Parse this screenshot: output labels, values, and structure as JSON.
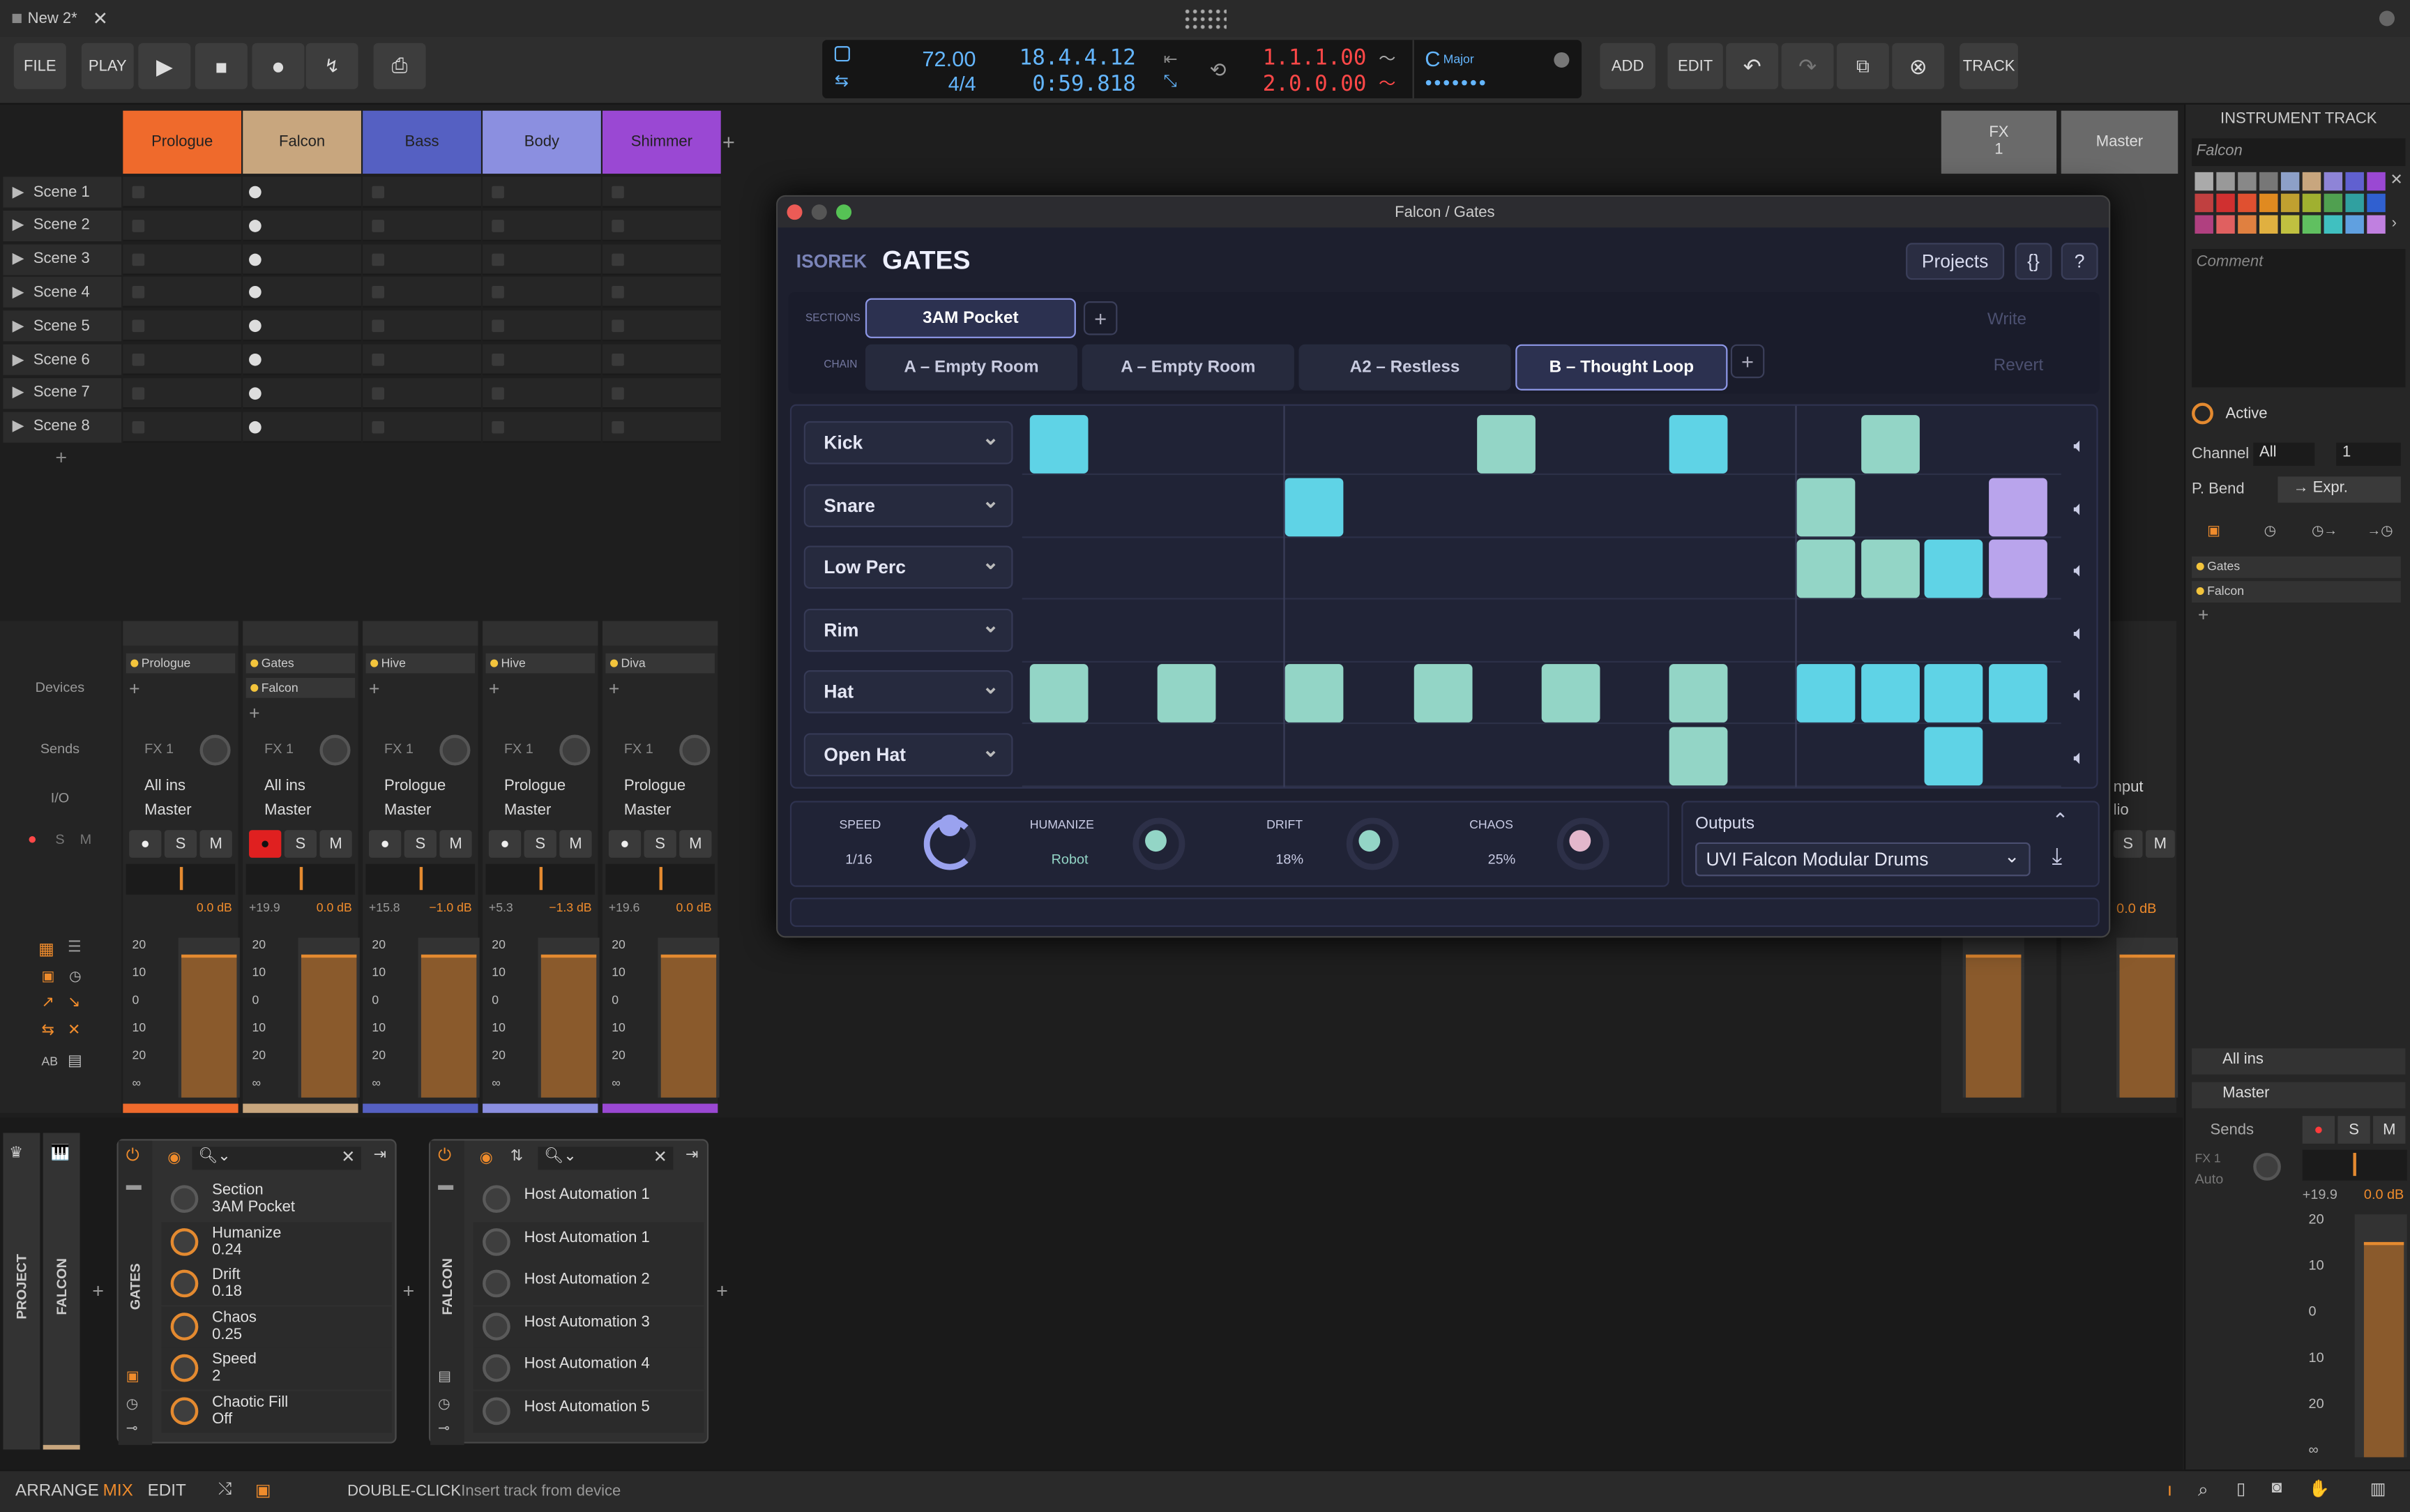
{
  "titlebar": {
    "tab": "New 2*"
  },
  "toolbar": {
    "file": "FILE",
    "play": "PLAY",
    "add": "ADD",
    "edit": "EDIT",
    "track": "TRACK",
    "tempo": "72.00",
    "sig": "4/4",
    "position": "18.4.4.12",
    "time": "0:59.818",
    "loop_start": "1.1.1.00",
    "loop_end": "2.0.0.00",
    "key_note": "C",
    "key_mode": "Major"
  },
  "tracks": [
    "Prologue",
    "Falcon",
    "Bass",
    "Body",
    "Shimmer"
  ],
  "track_colors": [
    "#ef6a2c",
    "#c8a67e",
    "#5560c2",
    "#8b8fe0",
    "#9a48d3"
  ],
  "fx": {
    "fx1_line1": "FX",
    "fx1_line2": "1",
    "master": "Master"
  },
  "scenes": [
    "Scene 1",
    "Scene 2",
    "Scene 3",
    "Scene 4",
    "Scene 5",
    "Scene 6",
    "Scene 7",
    "Scene 8"
  ],
  "mixer": {
    "section_devices": "Devices",
    "section_sends": "Sends",
    "section_io": "I/O",
    "strips": [
      {
        "devices": [
          "Prologue"
        ],
        "send": "FX 1",
        "input": "All ins",
        "output": "Master",
        "peak": "",
        "vol": "0.0 dB"
      },
      {
        "devices": [
          "Gates",
          "Falcon"
        ],
        "send": "FX 1",
        "input": "All ins",
        "output": "Master",
        "peak": "+19.9",
        "vol": "0.0 dB"
      },
      {
        "devices": [
          "Hive"
        ],
        "send": "FX 1",
        "input": "Prologue",
        "output": "Master",
        "peak": "+15.8",
        "vol": "−1.0 dB"
      },
      {
        "devices": [
          "Hive"
        ],
        "send": "FX 1",
        "input": "Prologue",
        "output": "Master",
        "peak": "+5.3",
        "vol": "−1.3 dB"
      },
      {
        "devices": [
          "Diva"
        ],
        "send": "FX 1",
        "input": "Prologue",
        "output": "Master",
        "peak": "+19.6",
        "vol": "0.0 dB"
      }
    ],
    "right_strips": [
      {
        "io_top": "nput",
        "io_bottom": "lio",
        "vol": "0.0 dB"
      }
    ],
    "scale": [
      "20",
      "10",
      "0",
      "10",
      "20",
      "∞"
    ],
    "solo": "S",
    "mute": "M"
  },
  "plugin": {
    "window_title": "Falcon / Gates",
    "brand": "ISOREK",
    "name": "GATES",
    "projects_btn": "Projects",
    "code_btn": "{}",
    "help_btn": "?",
    "sections_label": "SECTIONS",
    "section_active": "3AM Pocket",
    "chain_label": "CHAIN",
    "write_btn": "Write",
    "revert_btn": "Revert",
    "chain": [
      "A – Empty Room",
      "A – Empty Room",
      "A2 – Restless",
      "B – Thought Loop"
    ],
    "rows": [
      "Kick",
      "Snare",
      "Low Perc",
      "Rim",
      "Hat",
      "Open Hat"
    ],
    "speed_label": "SPEED",
    "speed_value": "1/16",
    "humanize_label": "HUMANIZE",
    "humanize_value": "Robot",
    "drift_label": "DRIFT",
    "drift_value": "18%",
    "chaos_label": "CHAOS",
    "chaos_value": "25%",
    "outputs_label": "Outputs",
    "outputs_value": "UVI Falcon Modular Drums"
  },
  "inspector": {
    "header": "INSTRUMENT TRACK",
    "track_name": "Falcon",
    "comment": "Comment",
    "active": "Active",
    "channel_label": "Channel",
    "channel_value": "All",
    "channel_num": "1",
    "pbend_label": "P. Bend",
    "pbend_value": "→ Expr.",
    "devices": [
      "Gates",
      "Falcon"
    ],
    "input": "All ins",
    "output": "Master",
    "sends": "Sends",
    "send_fx": "FX 1",
    "send_auto": "Auto",
    "peak": "+19.9",
    "vol": "0.0 dB",
    "scale": [
      "20",
      "10",
      "0",
      "10",
      "20",
      "∞"
    ]
  },
  "devicepanel": {
    "project": "PROJECT",
    "falcon_vert": "FALCON",
    "gates": {
      "title": "GATES",
      "params": [
        {
          "name": "Section",
          "value": "3AM Pocket"
        },
        {
          "name": "Humanize",
          "value": "0.24"
        },
        {
          "name": "Drift",
          "value": "0.18"
        },
        {
          "name": "Chaos",
          "value": "0.25"
        },
        {
          "name": "Speed",
          "value": "2"
        },
        {
          "name": "Chaotic Fill",
          "value": "Off"
        }
      ]
    },
    "falcon": {
      "title": "FALCON",
      "params": [
        "Host Automation 1",
        "Host Automation 1",
        "Host Automation 2",
        "Host Automation 3",
        "Host Automation 4",
        "Host Automation 5"
      ]
    }
  },
  "statusbar": {
    "arrange": "ARRANGE",
    "mix": "MIX",
    "edit": "EDIT",
    "hint_key": "DOUBLE-CLICK",
    "hint_text": "Insert track from device"
  },
  "gate_levels": {
    "humanize": 0.24,
    "drift": 0.18,
    "chaos": 0.25
  }
}
